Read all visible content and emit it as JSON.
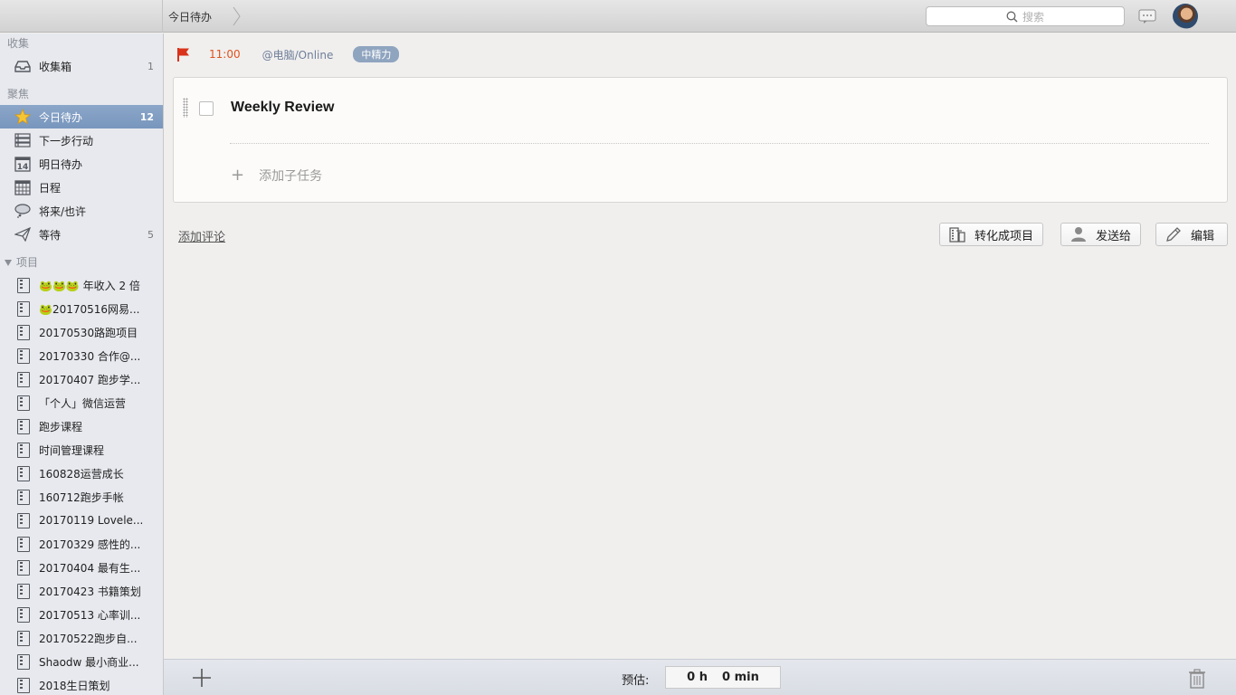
{
  "breadcrumb": {
    "current": "今日待办"
  },
  "search": {
    "placeholder": "搜索"
  },
  "sidebar": {
    "collect_title": "收集",
    "inbox": {
      "label": "收集箱",
      "count": "1"
    },
    "focus_title": "聚焦",
    "focus_items": [
      {
        "label": "今日待办",
        "count": "12",
        "icon": "star-icon"
      },
      {
        "label": "下一步行动",
        "count": "",
        "icon": "list-icon"
      },
      {
        "label": "明日待办",
        "count": "",
        "icon": "calendar-14-icon"
      },
      {
        "label": "日程",
        "count": "",
        "icon": "calendar-grid-icon"
      },
      {
        "label": "将来/也许",
        "count": "",
        "icon": "cloud-icon"
      },
      {
        "label": "等待",
        "count": "5",
        "icon": "paper-plane-icon"
      }
    ],
    "projects_title": "项目",
    "projects": [
      "🐸🐸🐸 年收入 2 倍",
      "🐸20170516网易...",
      "20170530路跑项目",
      "20170330 合作@...",
      "20170407 跑步学...",
      "「个人」微信运营",
      "跑步课程",
      "时间管理课程",
      "160828运营成长",
      "160712跑步手帐",
      "20170119 Lovele...",
      "20170329 感性的...",
      "20170404 最有生...",
      "20170423 书籍策划",
      "20170513 心率训...",
      "20170522跑步自...",
      "Shaodw 最小商业...",
      "2018生日策划"
    ]
  },
  "task": {
    "time": "11:00",
    "context": "@电脑/Online",
    "energy_tag": "中精力",
    "title": "Weekly Review",
    "add_subtask": "添加子任务"
  },
  "actions": {
    "add_comment": "添加评论",
    "convert_to_project": "转化成项目",
    "send_to": "发送给",
    "edit": "编辑"
  },
  "bottom": {
    "estimate_label": "预估:",
    "hours": "0 h",
    "minutes": "0 min"
  },
  "colors": {
    "accent_selected": "#7f9cc2",
    "flag_red": "#d9331a",
    "time_orange": "#e0521e",
    "tag_bg": "#8fa4bf"
  }
}
